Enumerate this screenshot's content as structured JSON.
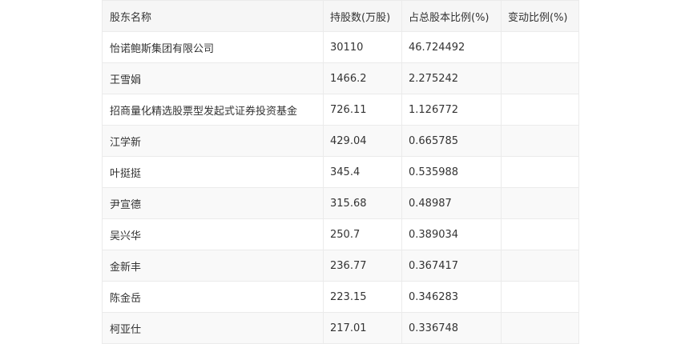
{
  "table": {
    "headers": [
      "股东名称",
      "持股数(万股)",
      "占总股本比例(%)",
      "变动比例(%)"
    ],
    "rows": [
      {
        "name": "怡诺鲍斯集团有限公司",
        "shares": "30110",
        "ratio": "46.724492",
        "change": ""
      },
      {
        "name": "王雪娟",
        "shares": "1466.2",
        "ratio": "2.275242",
        "change": ""
      },
      {
        "name": "招商量化精选股票型发起式证券投资基金",
        "shares": "726.11",
        "ratio": "1.126772",
        "change": ""
      },
      {
        "name": "江学新",
        "shares": "429.04",
        "ratio": "0.665785",
        "change": ""
      },
      {
        "name": "叶挺挺",
        "shares": "345.4",
        "ratio": "0.535988",
        "change": ""
      },
      {
        "name": "尹宣德",
        "shares": "315.68",
        "ratio": "0.48987",
        "change": ""
      },
      {
        "name": "吴兴华",
        "shares": "250.7",
        "ratio": "0.389034",
        "change": ""
      },
      {
        "name": "金新丰",
        "shares": "236.77",
        "ratio": "0.367417",
        "change": ""
      },
      {
        "name": "陈金岳",
        "shares": "223.15",
        "ratio": "0.346283",
        "change": ""
      },
      {
        "name": "柯亚仕",
        "shares": "217.01",
        "ratio": "0.336748",
        "change": ""
      }
    ]
  }
}
